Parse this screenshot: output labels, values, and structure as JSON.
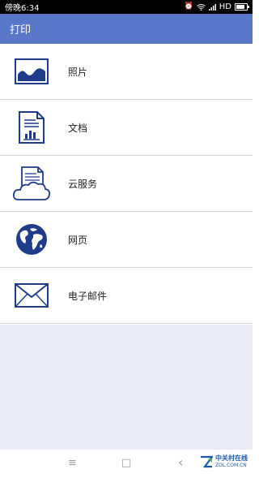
{
  "status_bar": {
    "time": "傍晚6:34",
    "network": "HD"
  },
  "app_bar": {
    "title": "打印"
  },
  "items": [
    {
      "label": "照片",
      "icon": "photo-icon"
    },
    {
      "label": "文档",
      "icon": "document-icon"
    },
    {
      "label": "云服务",
      "icon": "cloud-service-icon"
    },
    {
      "label": "网页",
      "icon": "globe-icon"
    },
    {
      "label": "电子邮件",
      "icon": "envelope-icon"
    }
  ],
  "nav_bar": {
    "menu_glyph": "≡",
    "home_glyph": "□",
    "back_glyph": "‹"
  },
  "watermark": {
    "cn": "中关村在线",
    "en": "ZOL.COM.CN"
  },
  "colors": {
    "app_bar": "#5877c9",
    "icon_blue": "#1f3c8a",
    "empty_area": "#e8eaf5"
  }
}
